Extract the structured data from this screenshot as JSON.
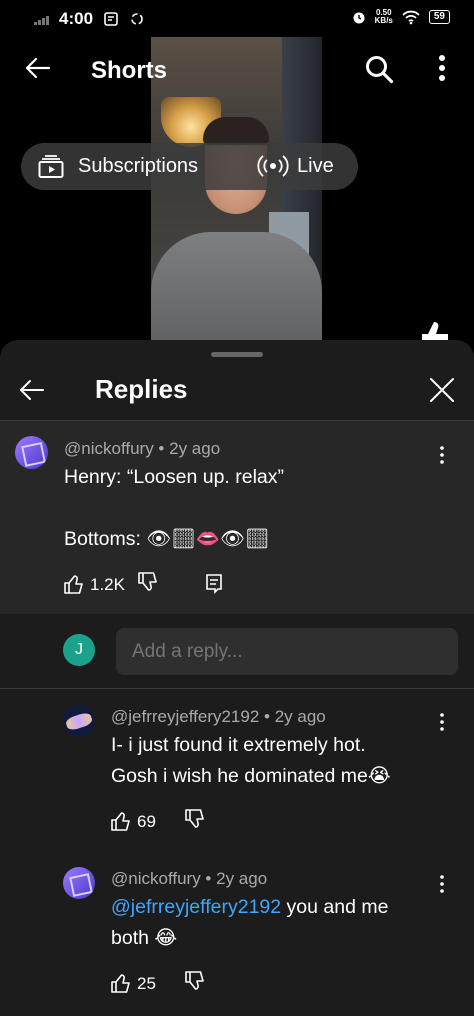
{
  "status_bar": {
    "time": "4:00",
    "net_speed_value": "0.50",
    "net_speed_unit": "KB/s",
    "battery": "59"
  },
  "top_bar": {
    "title": "Shorts"
  },
  "chips": {
    "subscriptions": "Subscriptions",
    "live": "Live"
  },
  "replies_sheet": {
    "title": "Replies",
    "parent_comment": {
      "author": "@nickoffury",
      "age": "2y ago",
      "text": "Henry: “Loosen up. relax”\n\nBottoms: 👁🏻👄👁🏻",
      "likes": "1.2K"
    },
    "reply_box": {
      "avatar_letter": "J",
      "placeholder": "Add a reply..."
    },
    "replies": [
      {
        "author": "@jefrreyjeffery2192",
        "age": "2y ago",
        "text": "I- i just found it extremely hot.\nGosh i wish he dominated me😭",
        "likes": "69"
      },
      {
        "author": "@nickoffury",
        "age": "2y ago",
        "mention": "@jefrreyjeffery2192",
        "text_after_mention": " you and me\nboth 😂",
        "likes": "25"
      }
    ]
  }
}
